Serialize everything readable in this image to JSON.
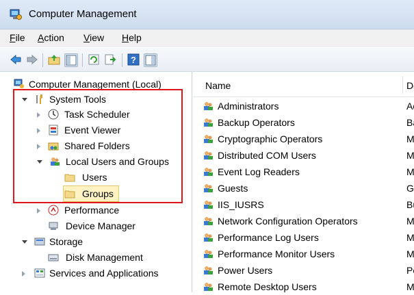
{
  "window": {
    "title": "Computer Management"
  },
  "menubar": {
    "items": [
      {
        "label": "File",
        "key": "F",
        "rest": "ile"
      },
      {
        "label": "Action",
        "key": "A",
        "rest": "ction"
      },
      {
        "label": "View",
        "key": "V",
        "rest": "iew"
      },
      {
        "label": "Help",
        "key": "H",
        "rest": "elp"
      }
    ]
  },
  "toolbar": {
    "buttons": [
      "back-icon",
      "forward-icon",
      "up-folder-icon",
      "show-hide-tree-icon",
      "refresh-icon",
      "export-icon",
      "help-icon",
      "show-action-pane-icon"
    ]
  },
  "tree": {
    "items": [
      {
        "label": "Computer Management (Local)",
        "state": "none"
      },
      {
        "label": "System Tools",
        "state": "expanded"
      },
      {
        "label": "Task Scheduler",
        "state": "collapsed"
      },
      {
        "label": "Event Viewer",
        "state": "collapsed"
      },
      {
        "label": "Shared Folders",
        "state": "collapsed"
      },
      {
        "label": "Local Users and Groups",
        "state": "expanded"
      },
      {
        "label": "Users",
        "state": "none"
      },
      {
        "label": "Groups",
        "state": "selected"
      },
      {
        "label": "Performance",
        "state": "collapsed"
      },
      {
        "label": "Device Manager",
        "state": "none"
      },
      {
        "label": "Storage",
        "state": "expanded"
      },
      {
        "label": "Disk Management",
        "state": "none"
      },
      {
        "label": "Services and Applications",
        "state": "collapsed"
      }
    ]
  },
  "list": {
    "columns": [
      "Name",
      "De"
    ],
    "rows": [
      {
        "name": "Administrators",
        "desc": "Ad"
      },
      {
        "name": "Backup Operators",
        "desc": "Ba"
      },
      {
        "name": "Cryptographic Operators",
        "desc": "M"
      },
      {
        "name": "Distributed COM Users",
        "desc": "M"
      },
      {
        "name": "Event Log Readers",
        "desc": "M"
      },
      {
        "name": "Guests",
        "desc": "Gu"
      },
      {
        "name": "IIS_IUSRS",
        "desc": "Bu"
      },
      {
        "name": "Network Configuration Operators",
        "desc": "M"
      },
      {
        "name": "Performance Log Users",
        "desc": "M"
      },
      {
        "name": "Performance Monitor Users",
        "desc": "M"
      },
      {
        "name": "Power Users",
        "desc": "Po"
      },
      {
        "name": "Remote Desktop Users",
        "desc": "M"
      }
    ]
  },
  "colors": {
    "highlight_box": "#e0161c",
    "selection_bg": "#fff3c4"
  }
}
